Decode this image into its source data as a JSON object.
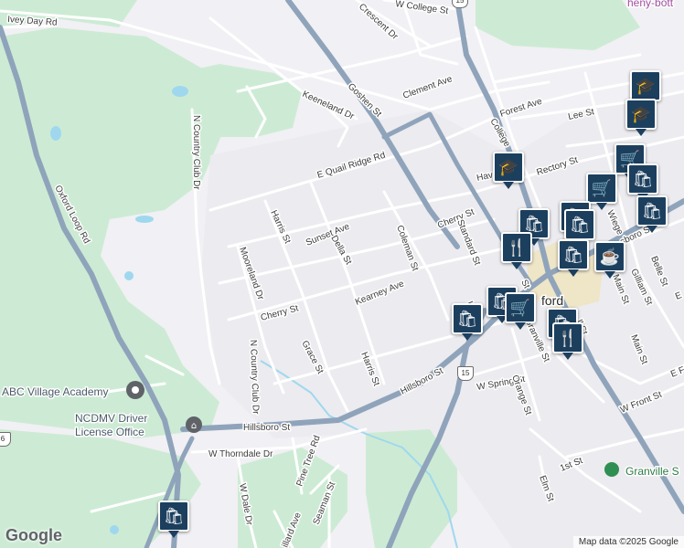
{
  "map": {
    "attribution": "Map data ©2025 Google",
    "logo": "Google",
    "town_label": "ford",
    "top_right_label": "heny-bott",
    "poi": {
      "abc_village_academy": "ABC Village Academy",
      "ncdmv_line1": "NCDMV Driver",
      "ncdmv_line2": "License Office",
      "granville": "Granville S"
    },
    "shields": {
      "us15_a": "15",
      "us15_b": "15",
      "edge": "6"
    },
    "streets": {
      "ivey_day_rd": "Ivey Day Rd",
      "w_college_st": "W College St",
      "crescent_dr": "Crescent Dr",
      "clement_ave": "Clement Ave",
      "keeneland_dr": "Keeneland Dr",
      "goshen_st": "Goshen St",
      "forest_ave": "Forest Ave",
      "lee_st": "Lee St",
      "college_st": "College",
      "n_country_club_dr": "N Country Club Dr",
      "e_quail_ridge_rd": "E Quail Ridge Rd",
      "rectory_st": "Rectory St",
      "hav": "Hav",
      "oxford_loop_rd": "Oxford Loop Rd",
      "harris_st_n": "Harris St",
      "sunset_ave": "Sunset Ave",
      "della_st": "Della St",
      "coleman_st": "Coleman St",
      "cherry_st_e": "Cherry St",
      "standard_st": "Standard St",
      "mooreland_dr": "Mooreland Dr",
      "kearney_ave": "Kearney Ave",
      "cherry_st_w": "Cherry St",
      "hillsboro_st": "Hillsboro St",
      "hillsboro_st_lower": "Hillsboro St",
      "grace_st": "Grace St",
      "harris_st_s": "Harris St",
      "n_country_club_dr_s": "N Country Club Dr",
      "w_spring_st": "W Spring St",
      "orange_st": "Orange St",
      "granville_st": "Granville St",
      "gilliam_st": "Gilliam St",
      "main_st": "Main St",
      "main_st_lower": "Main St",
      "belle_st": "Belle St",
      "boro_st": "sboro St",
      "w_front_st": "W Front St",
      "e_front": "E Fr",
      "w_thorndale_dr": "W Thorndale Dr",
      "pine_tree_rd": "Pine Tree Rd",
      "seaman_st": "Seaman St",
      "w_dale_dr": "W Dale Dr",
      "hillard_ave": "illard Ave",
      "first_st": "1st St",
      "elm_st": "Elm St",
      "e_label": "E",
      "st_label": "St",
      "ll_st": "ll St",
      "wiege": "Wiege",
      "l_label": "l"
    },
    "markers": [
      {
        "icon": "school-icon",
        "glyph": "🎓"
      },
      {
        "icon": "school-icon",
        "glyph": "🎓"
      },
      {
        "icon": "school-icon",
        "glyph": "🎓"
      },
      {
        "icon": "shopping-cart-icon",
        "glyph": "🛒"
      },
      {
        "icon": "shopping-bag-icon",
        "glyph": "🛍"
      },
      {
        "icon": "shopping-cart-icon",
        "glyph": "🛒"
      },
      {
        "icon": "shopping-bag-icon",
        "glyph": "🛍"
      },
      {
        "icon": "shopping-bag-icon",
        "glyph": "🛍"
      },
      {
        "icon": "shopping-bag-icon",
        "glyph": "🛍"
      },
      {
        "icon": "restaurant-icon",
        "glyph": "🍴"
      },
      {
        "icon": "shopping-bag-icon",
        "glyph": "🛍"
      },
      {
        "icon": "shopping-bag-icon",
        "glyph": "🛍"
      },
      {
        "icon": "cafe-icon",
        "glyph": "☕"
      },
      {
        "icon": "shopping-bag-icon",
        "glyph": "🛍"
      },
      {
        "icon": "shopping-cart-icon",
        "glyph": "🛒"
      },
      {
        "icon": "shopping-bag-icon",
        "glyph": "🛍"
      },
      {
        "icon": "shopping-bag-icon",
        "glyph": "🛍"
      },
      {
        "icon": "restaurant-icon",
        "glyph": "🍴"
      },
      {
        "icon": "shopping-bag-icon",
        "glyph": "🛍"
      }
    ],
    "colors": {
      "background": "#f1f0f4",
      "park": "#cdebd4",
      "highway": "#8fa4bb",
      "water": "#9fd8ee",
      "marker": "#1c3f5e"
    }
  }
}
